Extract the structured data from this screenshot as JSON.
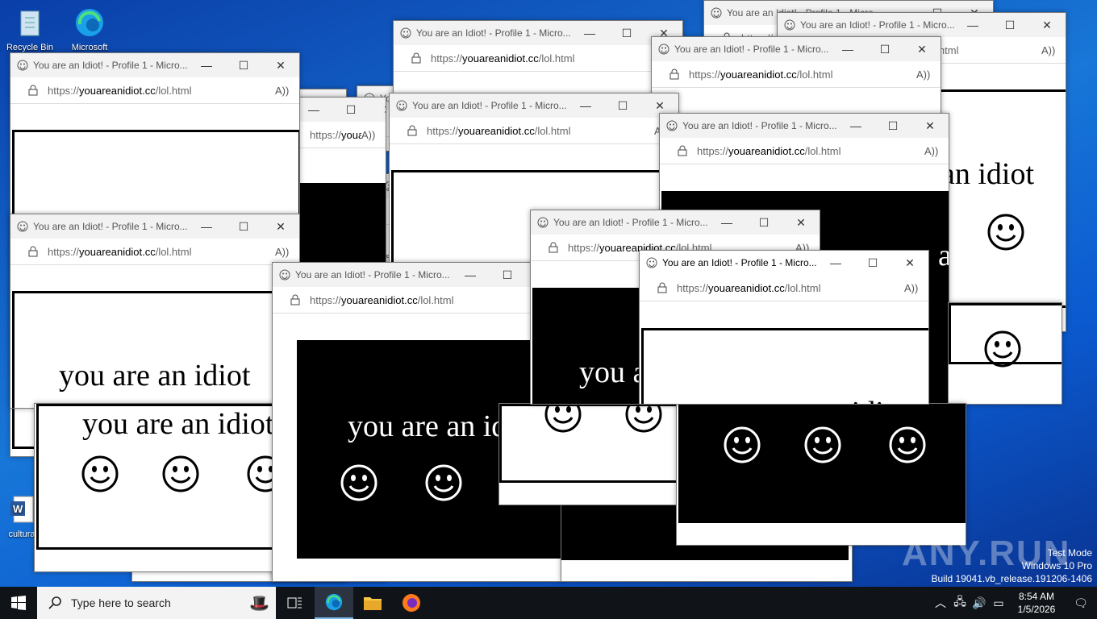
{
  "desktop": {
    "icons": [
      {
        "label": "Recycle Bin"
      },
      {
        "label": "Microsoft"
      },
      {
        "label": "cultura"
      }
    ]
  },
  "browser": {
    "title": "You are an Idiot! - Profile 1 - Micro...",
    "url_prefix": "https://",
    "url_domain": "youareanidiot.cc",
    "url_path": "/lol.html",
    "read_aloud": "A))",
    "min_glyph": "—",
    "max_glyph": "☐",
    "close_glyph": "✕"
  },
  "page": {
    "phrase": "you are an idiot"
  },
  "taskbar": {
    "search_placeholder": "Type here to search",
    "time": "8:54 AM",
    "date": "1/5/2026",
    "apps": [
      "task-view",
      "edge",
      "file-explorer",
      "firefox"
    ]
  },
  "watermark": {
    "line1": "Test Mode",
    "line2": "Windows 10 Pro",
    "line3": "Build 19041.vb_release.191206-1406",
    "brand": "ANY.RUN"
  },
  "colors": {
    "desktop": "#1877d8",
    "taskbar": "#101418",
    "accent": "#76b9ed"
  }
}
